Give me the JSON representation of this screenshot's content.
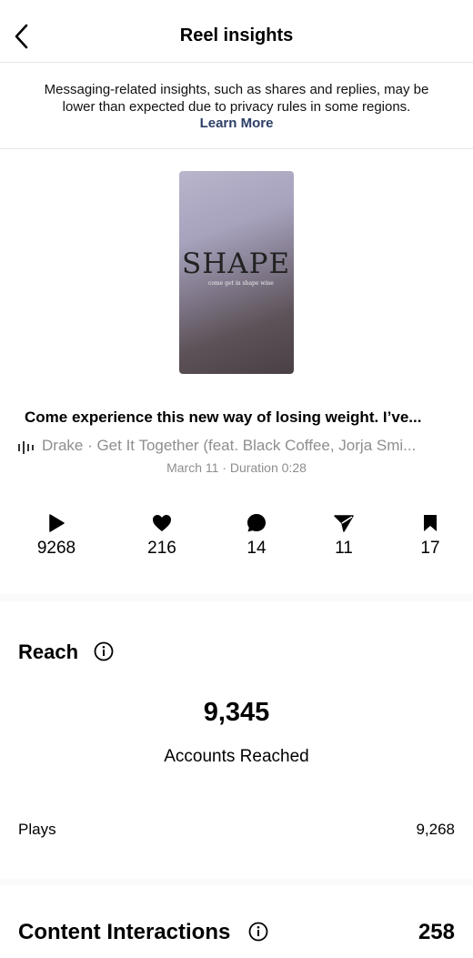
{
  "header": {
    "title": "Reel insights",
    "back_icon": "chevron-left-icon"
  },
  "notice": {
    "message": "Messaging-related insights, such as shares and replies, may be lower than expected due to privacy rules in some regions.",
    "link_label": "Learn More",
    "link_color": "#2c3e66"
  },
  "reel": {
    "thumbnail_title": "SHAPE",
    "thumbnail_tagline": "come get in shape wine",
    "caption": "Come experience this new way of losing weight. I’ve...",
    "audio": "Drake · Get It Together (feat. Black Coffee, Jorja Smi...",
    "meta": "March 11 · Duration 0:28"
  },
  "stats": [
    {
      "icon": "play-icon",
      "value": "9268"
    },
    {
      "icon": "heart-icon",
      "value": "216"
    },
    {
      "icon": "comment-icon",
      "value": "14"
    },
    {
      "icon": "share-icon",
      "value": "11"
    },
    {
      "icon": "bookmark-icon",
      "value": "17"
    }
  ],
  "reach": {
    "title": "Reach",
    "accounts_reached": "9,345",
    "accounts_reached_label": "Accounts Reached",
    "plays_label": "Plays",
    "plays_value": "9,268"
  },
  "content_interactions": {
    "title": "Content Interactions",
    "value": "258"
  }
}
